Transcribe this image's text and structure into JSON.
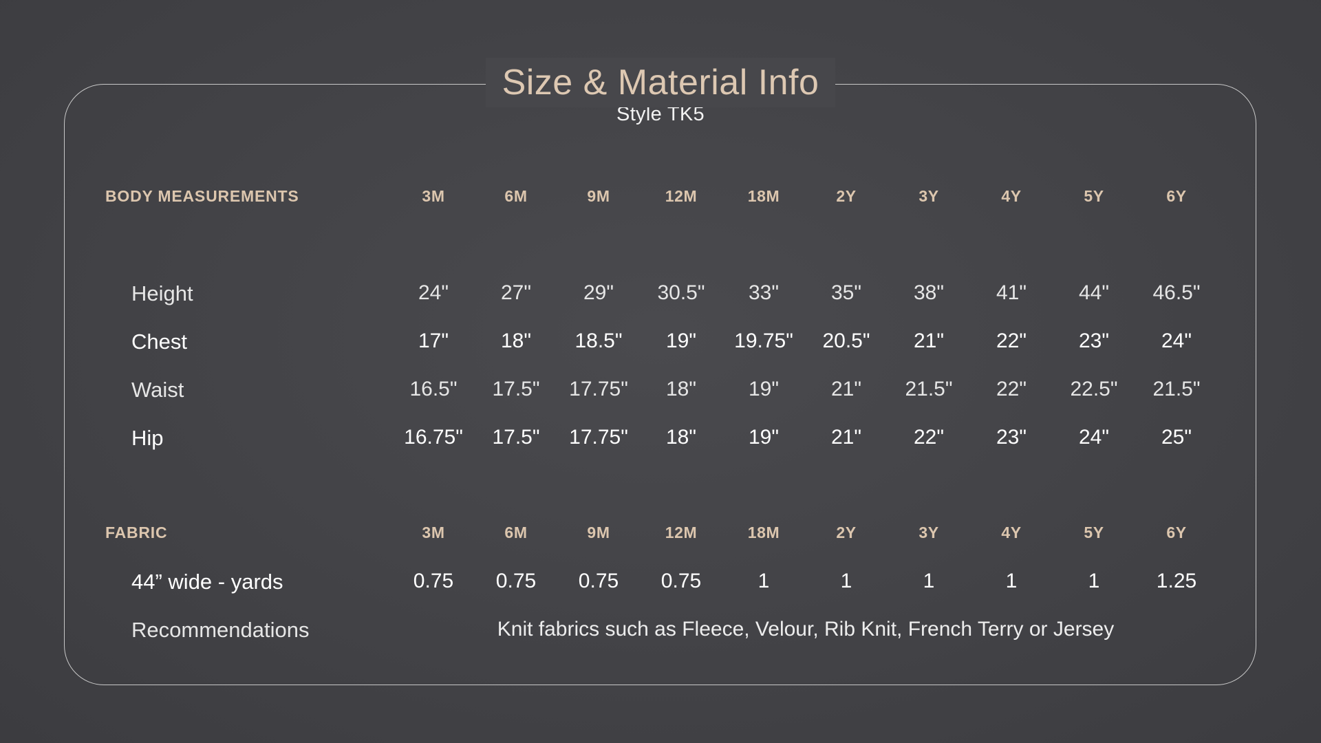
{
  "title": "Size & Material Info",
  "subtitle": "Style TK5",
  "body_section": {
    "label": "BODY MEASUREMENTS",
    "sizes": [
      "3M",
      "6M",
      "9M",
      "12M",
      "18M",
      "2Y",
      "3Y",
      "4Y",
      "5Y",
      "6Y"
    ],
    "rows": [
      {
        "label": "Height",
        "values": [
          "24\"",
          "27\"",
          "29\"",
          "30.5\"",
          "33\"",
          "35\"",
          "38\"",
          "41\"",
          "44\"",
          "46.5\""
        ]
      },
      {
        "label": "Chest",
        "values": [
          "17\"",
          "18\"",
          "18.5\"",
          "19\"",
          "19.75\"",
          "20.5\"",
          "21\"",
          "22\"",
          "23\"",
          "24\""
        ]
      },
      {
        "label": "Waist",
        "values": [
          "16.5\"",
          "17.5\"",
          "17.75\"",
          "18\"",
          "19\"",
          "21\"",
          "21.5\"",
          "22\"",
          "22.5\"",
          "21.5\""
        ]
      },
      {
        "label": "Hip",
        "values": [
          "16.75\"",
          "17.5\"",
          "17.75\"",
          "18\"",
          "19\"",
          "21\"",
          "22\"",
          "23\"",
          "24\"",
          "25\""
        ]
      }
    ]
  },
  "fabric_section": {
    "label": "FABRIC",
    "sizes": [
      "3M",
      "6M",
      "9M",
      "12M",
      "18M",
      "2Y",
      "3Y",
      "4Y",
      "5Y",
      "6Y"
    ],
    "yardage": {
      "label": "44” wide - yards",
      "values": [
        "0.75",
        "0.75",
        "0.75",
        "0.75",
        "1",
        "1",
        "1",
        "1",
        "1",
        "1.25"
      ]
    },
    "recommendations": {
      "label": "Recommendations",
      "text": "Knit fabrics such as Fleece, Velour, Rib Knit, French Terry or Jersey"
    }
  },
  "colors": {
    "background": "#47474b",
    "accent": "#dcc6ae",
    "text": "#ffffff",
    "border": "#c9c9c9"
  }
}
